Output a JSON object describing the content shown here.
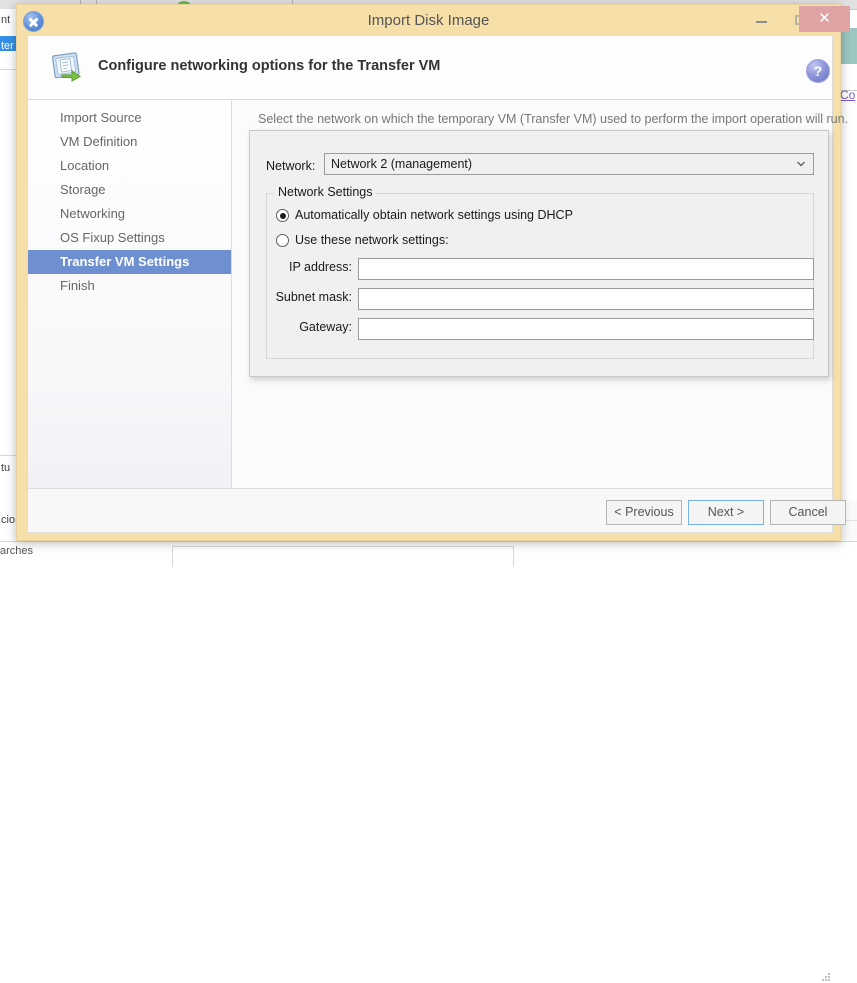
{
  "background": {
    "left_text_top": "nt",
    "left_selected_text": "ter",
    "left_text_lower1": "tu",
    "left_text_lower2": "cio",
    "bottom_text": "arches",
    "right_link": "Co"
  },
  "window": {
    "title": "Import Disk Image",
    "app_icon": "xencenter-x-icon",
    "controls": {
      "minimize": "minimize-icon",
      "maximize": "maximize-icon",
      "close": "✕"
    }
  },
  "header": {
    "icon": "import-disk-image-icon",
    "title": "Configure networking options for the Transfer VM",
    "help_label": "?"
  },
  "sidebar": {
    "items": [
      {
        "label": "Import Source",
        "selected": false
      },
      {
        "label": "VM Definition",
        "selected": false
      },
      {
        "label": "Location",
        "selected": false
      },
      {
        "label": "Storage",
        "selected": false
      },
      {
        "label": "Networking",
        "selected": false
      },
      {
        "label": "OS Fixup Settings",
        "selected": false
      },
      {
        "label": "Transfer VM Settings",
        "selected": true
      },
      {
        "label": "Finish",
        "selected": false
      }
    ],
    "logo": "citrix-logo"
  },
  "content": {
    "description": "Select the network on which the temporary VM (Transfer VM) used to perform the import operation will run.",
    "network_label": "Network:",
    "network_value": "Network 2 (management)",
    "network_placeholder": "",
    "groupbox_title": "Network Settings",
    "radios": [
      {
        "label": "Automatically obtain network settings using DHCP",
        "checked": true
      },
      {
        "label": "Use these network settings:",
        "checked": false
      }
    ],
    "fields": [
      {
        "label": "IP address:",
        "value": "",
        "placeholder": ""
      },
      {
        "label": "Subnet mask:",
        "value": "",
        "placeholder": ""
      },
      {
        "label": "Gateway:",
        "value": "",
        "placeholder": ""
      }
    ]
  },
  "footer": {
    "previous": "< Previous",
    "next": "Next >",
    "cancel": "Cancel"
  },
  "colors": {
    "window_chrome": "#f6dfa8",
    "close_button": "#dfa3a4",
    "sidebar_selected": "#6e90d0",
    "focus_border": "#7ab0e8",
    "help_button": "#8c93d8"
  }
}
